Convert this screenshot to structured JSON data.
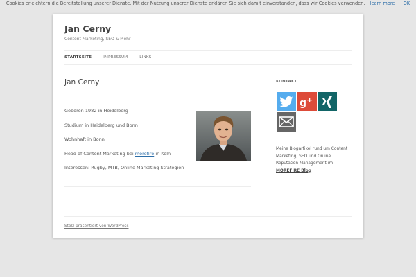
{
  "cookie_bar": {
    "text": "Cookies erleichtern die Bereitstellung unserer Dienste. Mit der Nutzung unserer Dienste erklären Sie sich damit einverstanden, dass wir Cookies verwenden.",
    "learn_more": "learn more",
    "ok": "OK"
  },
  "header": {
    "site_title": "Jan Cerny",
    "site_description": "Content Marketing, SEO & Mehr"
  },
  "nav": {
    "items": [
      {
        "label": "STARTSEITE",
        "active": true
      },
      {
        "label": "IMPRESSUM",
        "active": false
      },
      {
        "label": "LINKS",
        "active": false
      }
    ]
  },
  "main": {
    "title": "Jan Cerny",
    "bio": {
      "born": "Geboren 1982 in Heidelberg",
      "studies": "Studium in Heidelberg und Bonn",
      "residence": "Wohnhaft in Bonn",
      "job_prefix": "Head of Content Marketing bei ",
      "job_link": "morefire",
      "job_suffix": " in Köln",
      "interests": "Interessen: Rugby, MTB, Online Marketing Strategien"
    }
  },
  "sidebar": {
    "widget_title": "KONTAKT",
    "social_icons": [
      "twitter-icon",
      "google-plus-icon",
      "xing-icon",
      "mail-icon"
    ],
    "colors": {
      "twitter": "#55acee",
      "google_plus": "#dd4b39",
      "xing": "#126567",
      "mail": "#666666"
    },
    "text": "Meine Blogartikel rund um Content Marketing, SEO und Online Reputation Management im ",
    "blog_link": "MOREFIRE Blog"
  },
  "footer": {
    "credit": "Stolz präsentiert von WordPress"
  }
}
